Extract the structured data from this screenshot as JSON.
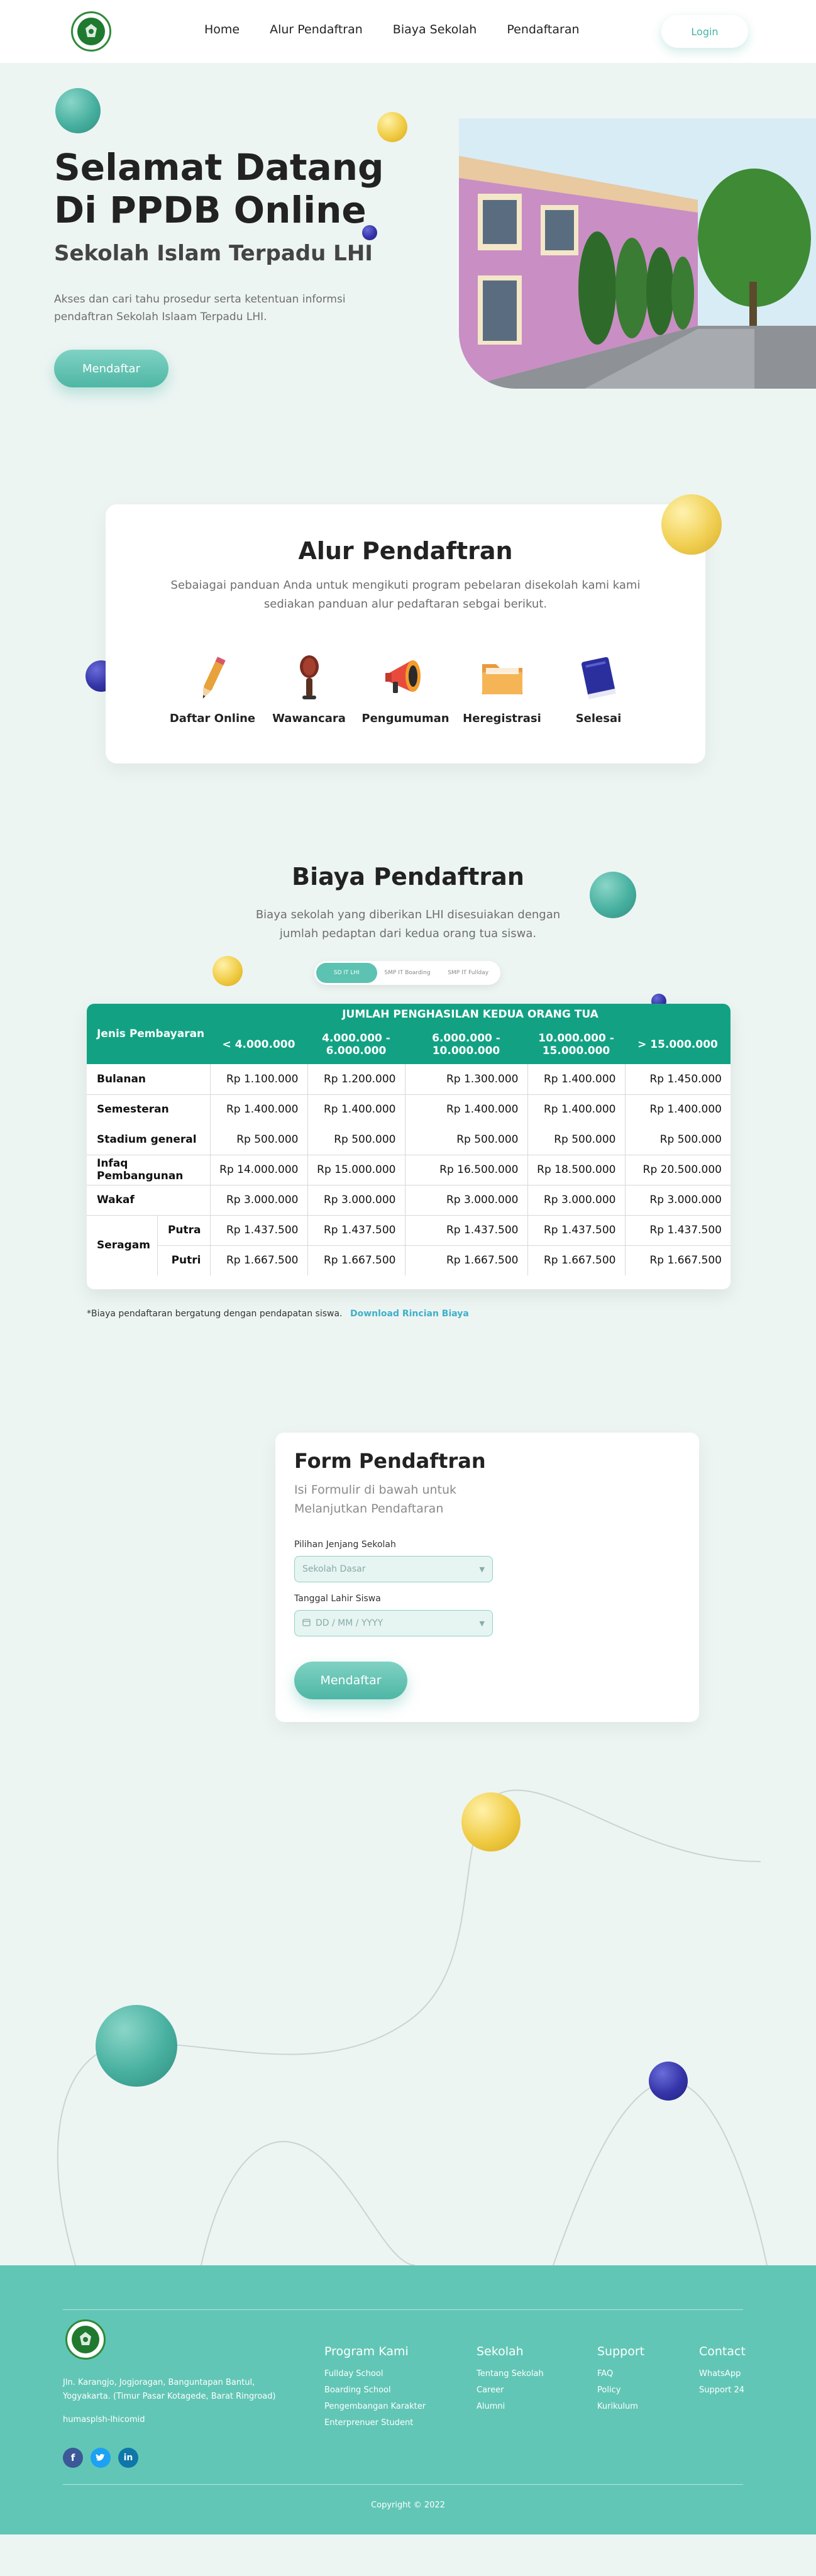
{
  "nav": {
    "links": [
      "Home",
      "Alur  Pendaftran",
      "Biaya Sekolah",
      "Pendaftaran"
    ],
    "login": "Login"
  },
  "hero": {
    "title_line1": "Selamat Datang",
    "title_line2": "Di PPDB Online",
    "subtitle": "Sekolah Islam Terpadu LHI",
    "description": "Akses dan cari tahu prosedur serta ketentuan informsi pendaftran Sekolah Islaam Terpadu  LHI.",
    "button": "Mendaftar"
  },
  "alur": {
    "title": "Alur Pendaftran",
    "description": "Sebaiagai panduan Anda untuk mengikuti program pebelaran disekolah kami kami sediakan panduan alur pedaftaran sebgai berikut.",
    "steps": [
      {
        "label": "Daftar Online",
        "icon": "pencil-icon"
      },
      {
        "label": "Wawancara",
        "icon": "microphone-icon"
      },
      {
        "label": "Pengumuman",
        "icon": "megaphone-icon"
      },
      {
        "label": "Heregistrasi",
        "icon": "folder-icon"
      },
      {
        "label": "Selesai",
        "icon": "book-icon"
      }
    ]
  },
  "biaya": {
    "title": "Biaya Pendaftran",
    "description": "Biaya sekolah yang diberikan LHI disesuiakan dengan jumlah pedaptan dari kedua orang tua siswa.",
    "toggle": [
      "SD IT LHI",
      "SMP IT Boarding",
      "SMP IT Fullday"
    ],
    "table": {
      "row_header": "Jenis Pembayaran",
      "group_header": "JUMLAH PENGHASILAN KEDUA ORANG TUA",
      "columns": [
        "< 4.000.000",
        "4.000.000 - 6.000.000",
        "6.000.000 - 10.000.000",
        "10.000.000 - 15.000.000",
        "> 15.000.000"
      ],
      "rows": [
        {
          "label": "Bulanan",
          "values": [
            "Rp 1.100.000",
            "Rp 1.200.000",
            "Rp 1.300.000",
            "Rp 1.400.000",
            "Rp 1.450.000"
          ]
        },
        {
          "label": "Semesteran",
          "values": [
            "Rp 1.400.000",
            "Rp 1.400.000",
            "Rp 1.400.000",
            "Rp 1.400.000",
            "Rp 1.400.000"
          ]
        },
        {
          "label": "Stadium general",
          "values": [
            "Rp 500.000",
            "Rp 500.000",
            "Rp 500.000",
            "Rp 500.000",
            "Rp 500.000"
          ]
        },
        {
          "label": "Infaq Pembangunan",
          "values": [
            "Rp 14.000.000",
            "Rp 15.000.000",
            "Rp 16.500.000",
            "Rp 18.500.000",
            "Rp 20.500.000"
          ]
        },
        {
          "label": "Wakaf",
          "values": [
            "Rp 3.000.000",
            "Rp 3.000.000",
            "Rp 3.000.000",
            "Rp 3.000.000",
            "Rp 3.000.000"
          ]
        }
      ],
      "seragam": {
        "label": "Seragam",
        "rows": [
          {
            "label": "Putra",
            "values": [
              "Rp 1.437.500",
              "Rp 1.437.500",
              "Rp 1.437.500",
              "Rp 1.437.500",
              "Rp 1.437.500"
            ]
          },
          {
            "label": "Putri",
            "values": [
              "Rp 1.667.500",
              "Rp 1.667.500",
              "Rp 1.667.500",
              "Rp 1.667.500",
              "Rp 1.667.500"
            ]
          }
        ]
      }
    },
    "note": "*Biaya pendaftaran bergatung dengan pendapatan siswa.",
    "download": "Download Rincian Biaya"
  },
  "form": {
    "title": "Form Pendaftran",
    "subtitle": "Isi Formulir di bawah untuk Melanjutkan Pendaftaran",
    "jenjang_label": "Pilihan Jenjang Sekolah",
    "jenjang_value": "Sekolah Dasar",
    "lahir_label": "Tanggal Lahir Siswa",
    "lahir_placeholder": "DD / MM / YYYY",
    "button": "Mendaftar"
  },
  "footer": {
    "address": "Jln. Karangjo, Jogjoragan, Banguntapan Bantul, Yogyakarta.  (Timur Pasar Kotagede, Barat Ringroad)",
    "email": "humasplsh-lhicomid",
    "columns": [
      {
        "title": "Program Kami",
        "items": [
          "Fullday School",
          "Boarding School",
          "Pengembangan Karakter",
          "Enterprenuer Student"
        ]
      },
      {
        "title": "Sekolah",
        "items": [
          "Tentang Sekolah",
          "Career",
          "Alumni"
        ]
      },
      {
        "title": "Support",
        "items": [
          "FAQ",
          "Policy",
          "Kurikulum"
        ]
      },
      {
        "title": "Contact",
        "items": [
          "WhatsApp",
          "Support 24"
        ]
      }
    ],
    "copyright": "Copyright © 2022"
  },
  "colors": {
    "accent": "#5cc2b1",
    "table_header": "#12a283",
    "footer": "#62c6b6",
    "ball_yellow": "#f0cc45",
    "ball_navy": "#3434a8"
  }
}
